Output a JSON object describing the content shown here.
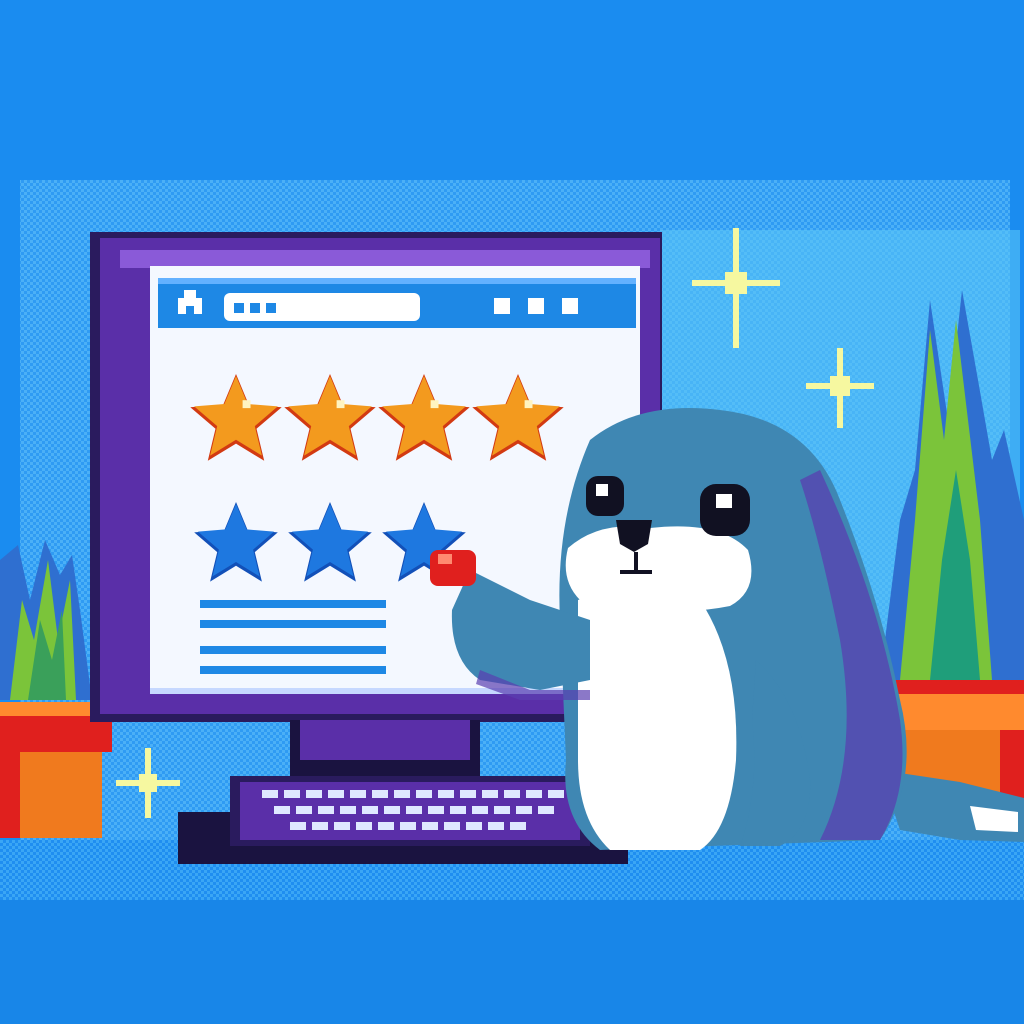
{
  "scene": {
    "subject": "seal-at-computer-rating-stars",
    "colors": {
      "background": "#1a8cf0",
      "dither_band": "#3aa6f5",
      "monitor_frame": "#5a2fa8",
      "screen": "#f4f8ff",
      "browser_bar": "#1e88e5",
      "gold_star": "#f39a1e",
      "blue_star": "#1e78e0",
      "seal_body": "#3f87b3",
      "seal_belly": "#ffffff",
      "plant": "#7bc43a",
      "pot": "#f07a1e",
      "sparkle": "#f6f8a0"
    }
  },
  "rating": {
    "filled_stars": 4,
    "blue_stars": 3
  },
  "icons": {
    "browser_home": "home-icon",
    "window_buttons": [
      "window-button-icon",
      "window-button-icon",
      "window-button-icon"
    ]
  }
}
